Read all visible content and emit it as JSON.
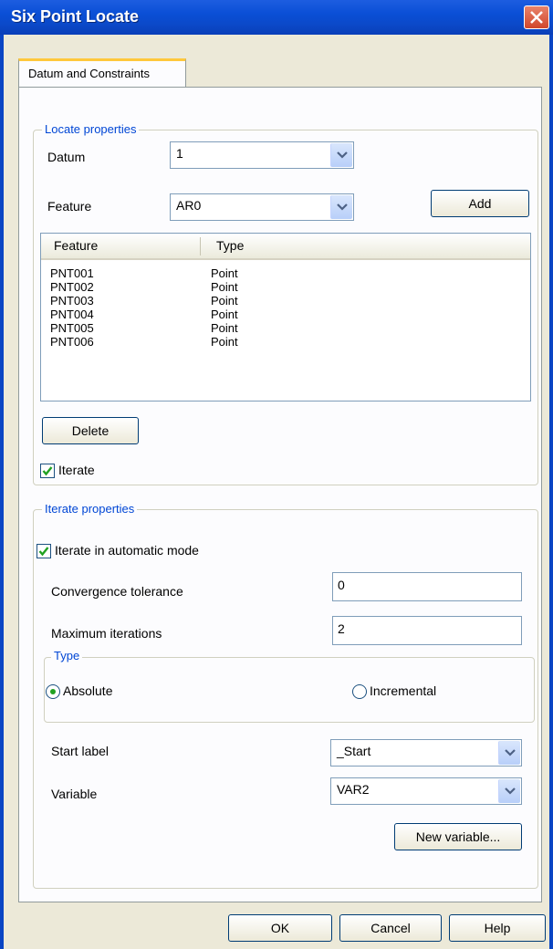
{
  "window": {
    "title": "Six Point Locate"
  },
  "tabs": [
    {
      "label": "Datum and Constraints"
    }
  ],
  "locate": {
    "group_title": "Locate properties",
    "datum_label": "Datum",
    "datum_value": "1",
    "feature_label": "Feature",
    "feature_value": "AR0",
    "add_label": "Add",
    "list_headers": [
      "Feature",
      "Type"
    ],
    "rows": [
      {
        "feature": "PNT001",
        "type": "Point"
      },
      {
        "feature": "PNT002",
        "type": "Point"
      },
      {
        "feature": "PNT003",
        "type": "Point"
      },
      {
        "feature": "PNT004",
        "type": "Point"
      },
      {
        "feature": "PNT005",
        "type": "Point"
      },
      {
        "feature": "PNT006",
        "type": "Point"
      }
    ],
    "delete_label": "Delete",
    "iterate_label": "Iterate",
    "iterate_checked": true
  },
  "iterate": {
    "group_title": "Iterate properties",
    "auto_label": "Iterate in automatic mode",
    "auto_checked": true,
    "tolerance_label": "Convergence tolerance",
    "tolerance_value": "0",
    "max_iter_label": "Maximum iterations",
    "max_iter_value": "2",
    "type_title": "Type",
    "absolute_label": "Absolute",
    "incremental_label": "Incremental",
    "selected_type": "Absolute",
    "start_label": "Start label",
    "start_value": "_Start",
    "variable_label": "Variable",
    "variable_value": "VAR2",
    "new_variable_label": "New variable..."
  },
  "footer": {
    "ok_label": "OK",
    "cancel_label": "Cancel",
    "help_label": "Help"
  }
}
